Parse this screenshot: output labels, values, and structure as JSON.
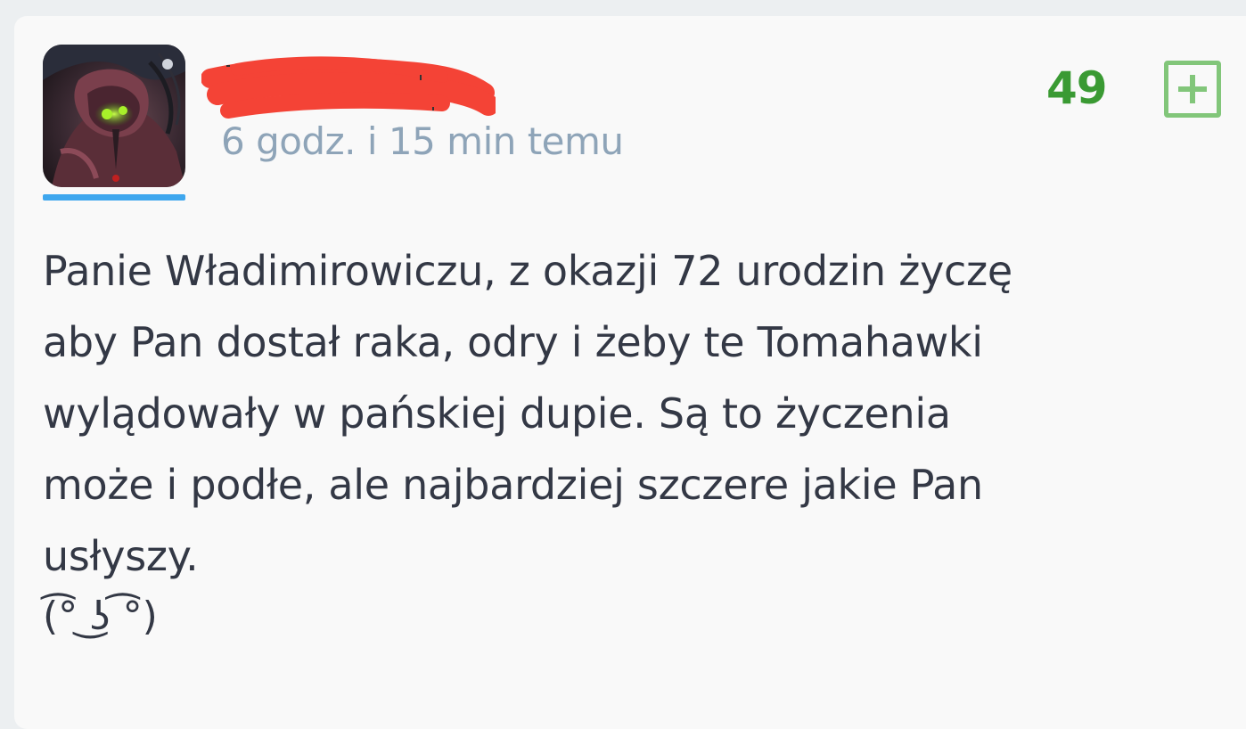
{
  "entry": {
    "author_name": "",
    "timestamp": "6 godz. i 15 min temu",
    "vote_count": "49",
    "vote_button_label": "+",
    "content": "Panie Władimirowiczu, z okazji 72 urodzin życzę\naby Pan dostał raka, odry i żeby te Tomahawki\nwylądowały w pańskiej dupie. Są to życzenia\nmoże i podłe, ale najbardziej szczere jakie Pan\nusłyszy.",
    "emoticon": "(͡° ͜ʖ ͡°)"
  },
  "icons": {
    "vote": "plus-icon",
    "avatar": "avatar-image",
    "redaction": "redaction-scribble"
  },
  "colors": {
    "vote_count": "#3a9a33",
    "vote_button": "#82c67a",
    "timestamp": "#8ea4b8",
    "avatar_bar": "#3fa7ee",
    "redaction": "#f44336",
    "text": "#333845"
  }
}
